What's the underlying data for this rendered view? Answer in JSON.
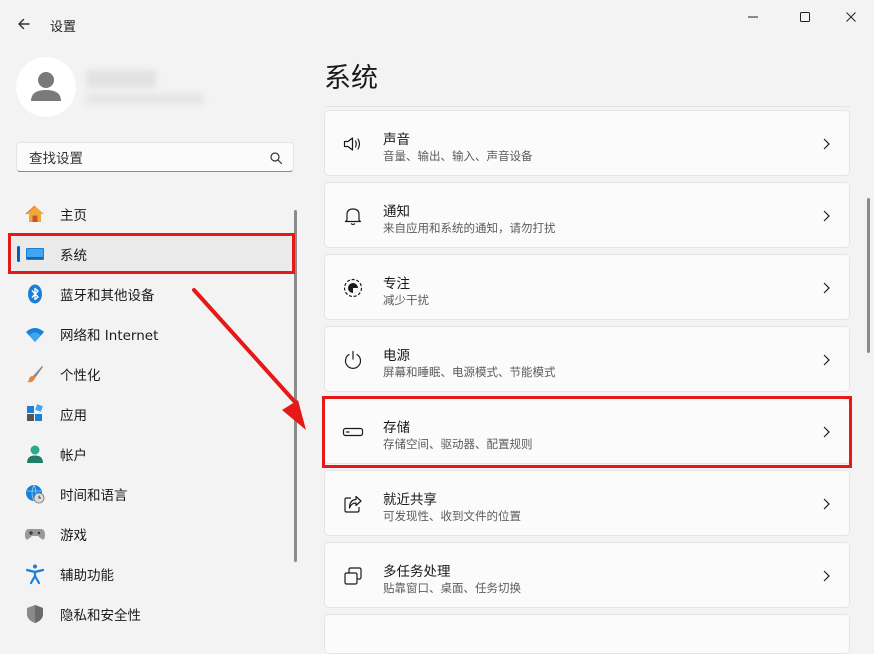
{
  "app": {
    "title": "设置"
  },
  "search": {
    "placeholder": "查找设置"
  },
  "sidebar": {
    "items": [
      {
        "label": "主页",
        "icon": "home-icon"
      },
      {
        "label": "系统",
        "icon": "system-display-icon",
        "selected": true
      },
      {
        "label": "蓝牙和其他设备",
        "icon": "bluetooth-icon"
      },
      {
        "label": "网络和 Internet",
        "icon": "wifi-icon"
      },
      {
        "label": "个性化",
        "icon": "paintbrush-icon"
      },
      {
        "label": "应用",
        "icon": "apps-icon"
      },
      {
        "label": "帐户",
        "icon": "account-icon"
      },
      {
        "label": "时间和语言",
        "icon": "globe-clock-icon"
      },
      {
        "label": "游戏",
        "icon": "gamepad-icon"
      },
      {
        "label": "辅助功能",
        "icon": "accessibility-icon"
      },
      {
        "label": "隐私和安全性",
        "icon": "shield-icon"
      }
    ]
  },
  "main": {
    "title": "系统",
    "cards": [
      {
        "title": "声音",
        "subtitle": "音量、输出、输入、声音设备",
        "icon": "speaker-icon"
      },
      {
        "title": "通知",
        "subtitle": "来自应用和系统的通知，请勿打扰",
        "icon": "bell-icon"
      },
      {
        "title": "专注",
        "subtitle": "减少干扰",
        "icon": "focus-icon"
      },
      {
        "title": "电源",
        "subtitle": "屏幕和睡眠、电源模式、节能模式",
        "icon": "power-icon"
      },
      {
        "title": "存储",
        "subtitle": "存储空间、驱动器、配置规则",
        "icon": "storage-drive-icon",
        "highlighted": true
      },
      {
        "title": "就近共享",
        "subtitle": "可发现性、收到文件的位置",
        "icon": "share-icon"
      },
      {
        "title": "多任务处理",
        "subtitle": "贴靠窗口、桌面、任务切换",
        "icon": "multitask-icon"
      }
    ]
  },
  "colors": {
    "accent": "#005fb8",
    "annotation": "#e61919",
    "background": "#f3f3f3"
  }
}
